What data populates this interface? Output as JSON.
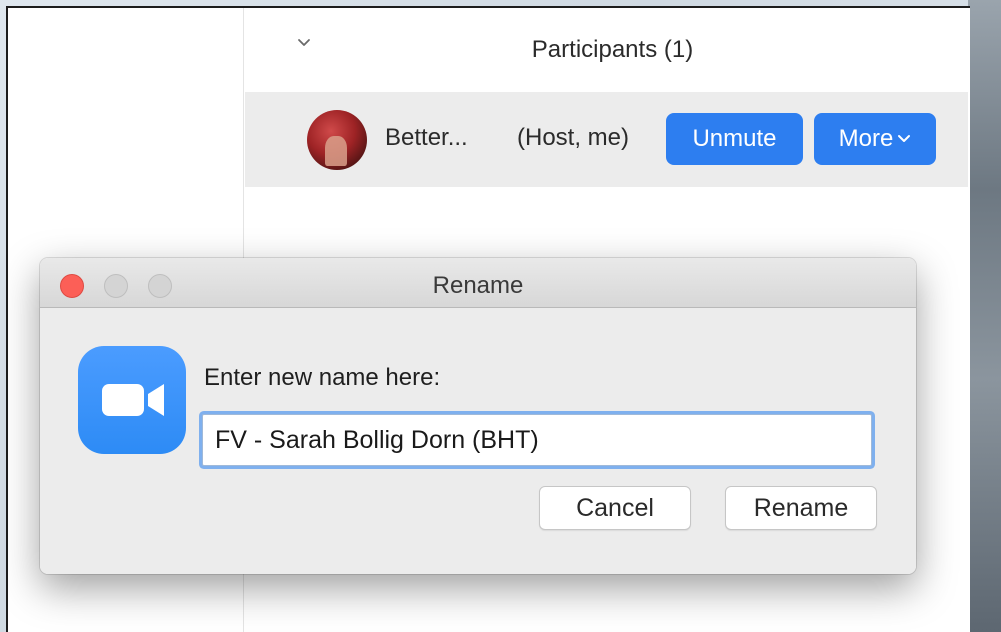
{
  "participants": {
    "title": "Participants (1)",
    "row": {
      "name": "Better...",
      "role": "(Host, me)",
      "unmute_label": "Unmute",
      "more_label": "More"
    }
  },
  "rename_dialog": {
    "title": "Rename",
    "prompt": "Enter new name here:",
    "input_value": "FV - Sarah Bollig Dorn (BHT)",
    "cancel_label": "Cancel",
    "rename_label": "Rename",
    "icon": "zoom-video-camera-icon"
  },
  "colors": {
    "accent_blue": "#2d7ef0",
    "close_red": "#fc5f57",
    "zoom_blue": "#2d8bf5"
  }
}
